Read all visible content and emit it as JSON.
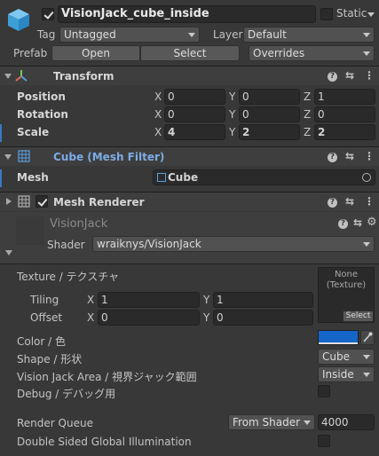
{
  "object": {
    "name": "VisionJack_cube_inside",
    "static_label": "Static",
    "tag_label": "Tag",
    "tag_value": "Untagged",
    "layer_label": "Layer",
    "layer_value": "Default",
    "prefab_label": "Prefab",
    "prefab_open": "Open",
    "prefab_select": "Select",
    "prefab_overrides": "Overrides"
  },
  "transform": {
    "title": "Transform",
    "rows": [
      {
        "label": "Position",
        "x": "0",
        "y": "0",
        "z": "1"
      },
      {
        "label": "Rotation",
        "x": "0",
        "y": "0",
        "z": "0"
      },
      {
        "label": "Scale",
        "x": "4",
        "y": "2",
        "z": "2"
      }
    ],
    "axis_x": "X",
    "axis_y": "Y",
    "axis_z": "Z"
  },
  "mesh_filter": {
    "title": "Cube (Mesh Filter)",
    "mesh_label": "Mesh",
    "mesh_value": "Cube"
  },
  "mesh_renderer": {
    "title": "Mesh Renderer"
  },
  "material": {
    "name": "VisionJack",
    "shader_label": "Shader",
    "shader_value": "wraiknys/VisionJack",
    "texture_label": "Texture / テクスチャ",
    "texture_none": "None\n(Texture)",
    "texture_select": "Select",
    "tiling_label": "Tiling",
    "tiling_x": "1",
    "tiling_y": "1",
    "offset_label": "Offset",
    "offset_x": "0",
    "offset_y": "0",
    "color_label": "Color / 色",
    "color_value": "#1565c8",
    "shape_label": "Shape / 形状",
    "shape_value": "Cube",
    "area_label": "Vision Jack Area / 視界ジャック範囲",
    "area_value": "Inside",
    "debug_label": "Debug / デバッグ用",
    "render_queue_label": "Render Queue",
    "render_queue_mode": "From Shader",
    "render_queue_value": "4000",
    "dsgi_label": "Double Sided Global Illumination"
  }
}
